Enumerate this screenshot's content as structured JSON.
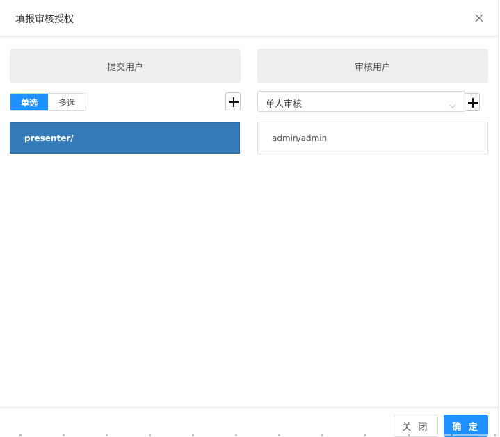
{
  "dialog": {
    "title": "填报审核授权"
  },
  "left_panel": {
    "header": "提交用户",
    "segment": {
      "options": [
        "单选",
        "多选"
      ],
      "selected": "单选"
    },
    "items": [
      {
        "label": "presenter/",
        "selected": true
      }
    ]
  },
  "right_panel": {
    "header": "审核用户",
    "review_mode": {
      "value": "单人审核"
    },
    "items": [
      {
        "label": "admin/admin",
        "selected": false
      }
    ]
  },
  "footer": {
    "close_label": "关 闭",
    "ok_label": "确 定"
  },
  "colors": {
    "accent": "#1e90ff",
    "selected_row": "#337ab7",
    "panel_header_bg": "#eeeeee"
  },
  "icons": [
    "close-icon",
    "plus-icon",
    "chevron-down-icon"
  ]
}
